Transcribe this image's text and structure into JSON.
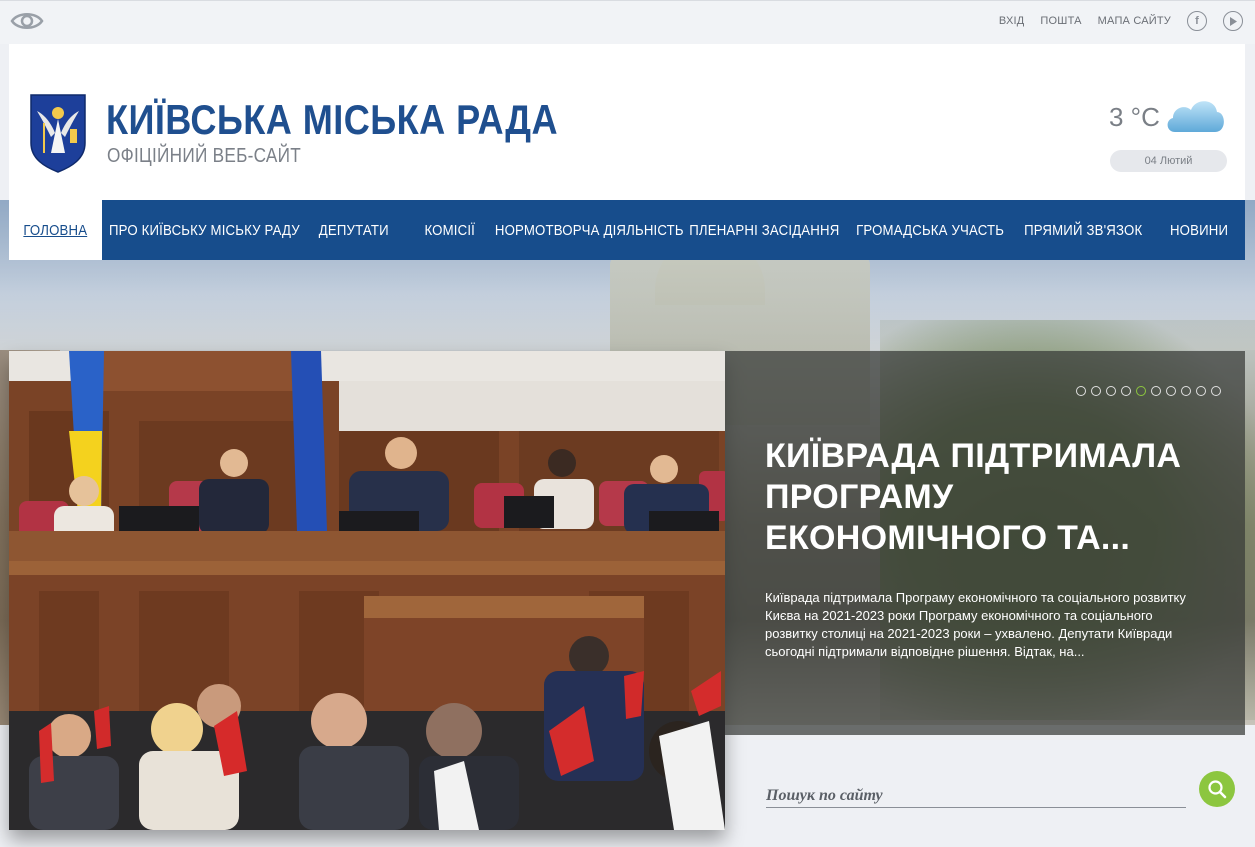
{
  "topbar": {
    "links": [
      "ВХІД",
      "ПОШТА",
      "МАПА САЙТУ"
    ],
    "icons": [
      "accessibility-eye-icon",
      "facebook-icon",
      "youtube-play-icon"
    ]
  },
  "header": {
    "title": "КИЇВСЬКА МІСЬКА РАДА",
    "subtitle": "ОФІЦІЙНИЙ ВЕБ-САЙТ",
    "weather": {
      "temp": "3 °C",
      "date": "04 Лютий",
      "icon": "cloud-icon"
    }
  },
  "nav": {
    "items": [
      {
        "label": "ГОЛОВНА",
        "active": true
      },
      {
        "label": "ПРО КИЇВСЬКУ МІСЬКУ РАДУ",
        "active": false
      },
      {
        "label": "ДЕПУТАТИ",
        "active": false
      },
      {
        "label": "КОМІСІЇ",
        "active": false
      },
      {
        "label": "НОРМОТВОРЧА ДІЯЛЬНІСТЬ",
        "active": false
      },
      {
        "label": "ПЛЕНАРНІ ЗАСІДАННЯ",
        "active": false
      },
      {
        "label": "ГРОМАДСЬКА УЧАСТЬ",
        "active": false
      },
      {
        "label": "ПРЯМИЙ ЗВ'ЯЗОК",
        "active": false
      },
      {
        "label": "НОВИНИ",
        "active": false
      }
    ]
  },
  "slider": {
    "title": "КИЇВРАДА ПІДТРИМАЛА ПРОГРАМУ ЕКОНОМІЧНОГО ТА...",
    "text": "Київрада підтримала Програму економічного та соціального розвитку Києва на 2021-2023 роки Програму економічного та соціального розвитку столиці на 2021-2023 роки – ухвалено. Депутати Київради сьогодні підтримали відповідне рішення. Відтак, на...",
    "dot_count": 10,
    "active_dot": 5,
    "colors": {
      "active_dot": "#8cc63f"
    }
  },
  "search": {
    "placeholder": "Пошук по сайту",
    "icon": "search-icon"
  },
  "colors": {
    "brand": "#174d8c",
    "title": "#1f4f8f",
    "accent": "#8cc63f"
  }
}
